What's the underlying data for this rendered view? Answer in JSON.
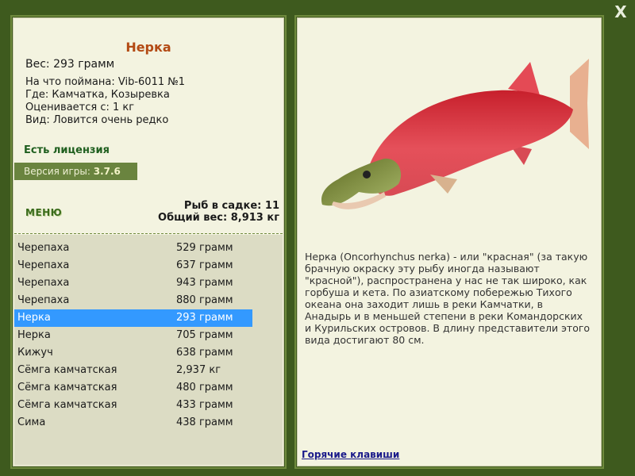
{
  "close_label": "X",
  "fish": {
    "name": "Нерка",
    "weight": "Вес: 293 грамм",
    "bait": "На что поймана: Vib-6011 №1",
    "place": "Где: Камчатка, Козыревка",
    "rating": "Оценивается с: 1 кг",
    "kind": "Вид: Ловится очень редко"
  },
  "license": "Есть лицензия",
  "version": {
    "label": "Версия игры: ",
    "value": "3.7.6"
  },
  "menu_label": "МЕНЮ",
  "stats": {
    "count": "Рыб в садке: 11",
    "total": "Общий вес: 8,913 кг"
  },
  "catch_list": [
    {
      "name": "Черепаха",
      "weight": "529 грамм"
    },
    {
      "name": "Черепаха",
      "weight": "637 грамм"
    },
    {
      "name": "Черепаха",
      "weight": "943 грамм"
    },
    {
      "name": "Черепаха",
      "weight": "880 грамм"
    },
    {
      "name": "Нерка",
      "weight": "293 грамм"
    },
    {
      "name": "Нерка",
      "weight": "705 грамм"
    },
    {
      "name": "Кижуч",
      "weight": "638 грамм"
    },
    {
      "name": "Сёмга камчатская",
      "weight": "2,937 кг"
    },
    {
      "name": "Сёмга камчатская",
      "weight": "480 грамм"
    },
    {
      "name": "Сёмга камчатская",
      "weight": "433 грамм"
    },
    {
      "name": "Сима",
      "weight": "438 грамм"
    }
  ],
  "selected_index": 4,
  "description": "Нерка (Oncorhynchus nerka) - или \"красная\" (за такую брачную окраску эту рыбу иногда называют \"красной\"), распространена у нас не так широко, как горбуша и кета. По азиатскому побережью Тихого океана она заходит лишь в реки Камчатки, в Анадырь и в меньшей степени в реки Командорских и Курильских островов. В длину представители этого вида достигают 80 см.",
  "hotkeys_label": "Горячие клавиши",
  "colors": {
    "accent": "#b34a14",
    "selected": "#3399ff",
    "frame": "#3e5a1e"
  }
}
